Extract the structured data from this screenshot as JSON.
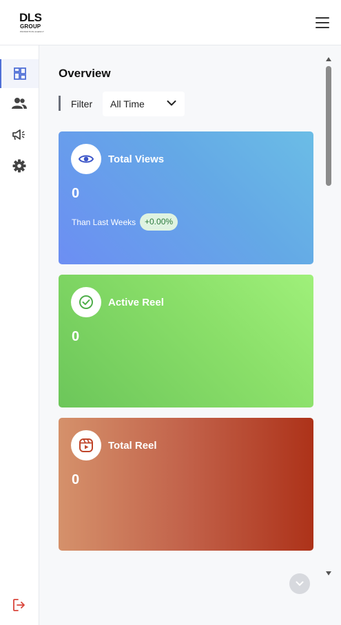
{
  "brand": {
    "logo_main": "DLS",
    "logo_sub": "GROUP",
    "logo_tagline": "PROMOTION AGENCY"
  },
  "header": {
    "menu_icon": "hamburger-menu-icon"
  },
  "sidebar": {
    "items": [
      {
        "name": "dashboard",
        "icon": "dashboard-icon",
        "active": true
      },
      {
        "name": "users",
        "icon": "users-icon",
        "active": false
      },
      {
        "name": "campaigns",
        "icon": "megaphone-icon",
        "active": false
      },
      {
        "name": "settings",
        "icon": "gear-icon",
        "active": false
      }
    ],
    "logout_icon": "logout-icon"
  },
  "main": {
    "title": "Overview",
    "filter": {
      "label": "Filter",
      "selected": "All Time"
    },
    "cards": [
      {
        "title": "Total Views",
        "value": "0",
        "subtitle": "Than Last Weeks",
        "badge": "+0.00%",
        "icon": "eye-icon"
      },
      {
        "title": "Active Reel",
        "value": "0",
        "icon": "check-circle-icon"
      },
      {
        "title": "Total Reel",
        "value": "0",
        "icon": "reel-play-icon"
      }
    ]
  },
  "colors": {
    "accent": "#4f6fd6",
    "card_views": "#6c8ef3",
    "card_active": "#8adf69",
    "card_total": "#c2624a",
    "logout": "#d9453b"
  }
}
